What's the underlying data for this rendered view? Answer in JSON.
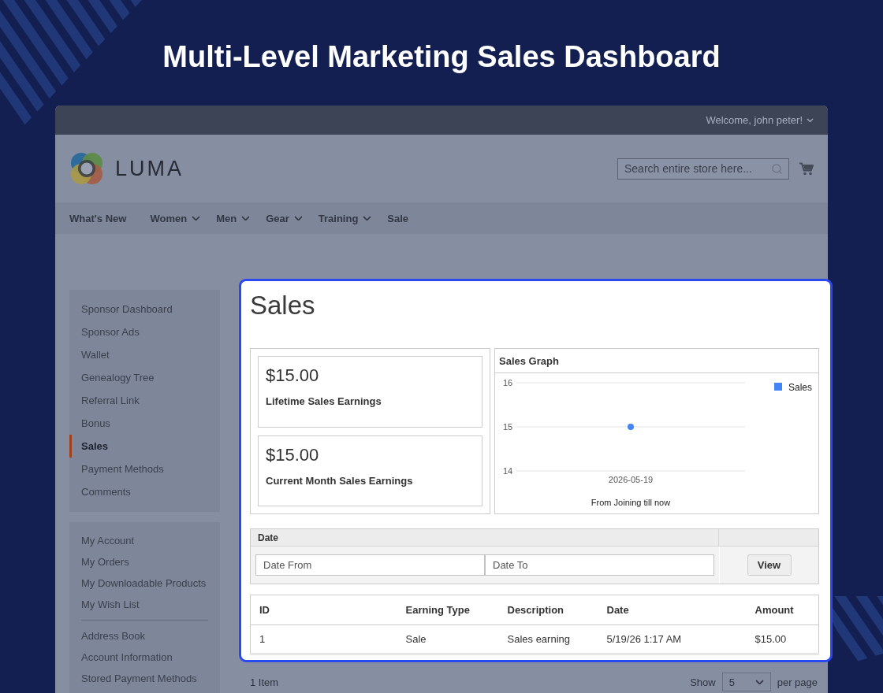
{
  "page_title": "Multi-Level Marketing Sales Dashboard",
  "top_bar": {
    "welcome": "Welcome, john peter!"
  },
  "header": {
    "logo_text": "LUMA",
    "search": {
      "placeholder": "Search entire store here..."
    }
  },
  "nav": [
    {
      "label": "What's New",
      "has_menu": false
    },
    {
      "label": "Women",
      "has_menu": true
    },
    {
      "label": "Men",
      "has_menu": true
    },
    {
      "label": "Gear",
      "has_menu": true
    },
    {
      "label": "Training",
      "has_menu": true
    },
    {
      "label": "Sale",
      "has_menu": false
    }
  ],
  "sidebar": [
    {
      "sections": [
        {
          "items": [
            {
              "label": "Sponsor Dashboard",
              "selected": false
            },
            {
              "label": "Sponsor Ads",
              "selected": false
            },
            {
              "label": "Wallet",
              "selected": false
            },
            {
              "label": "Genealogy Tree",
              "selected": false
            },
            {
              "label": "Referral Link",
              "selected": false
            },
            {
              "label": "Bonus",
              "selected": false
            },
            {
              "label": "Sales",
              "selected": true
            },
            {
              "label": "Payment Methods",
              "selected": false
            },
            {
              "label": "Comments",
              "selected": false
            }
          ]
        }
      ]
    },
    {
      "sections": [
        {
          "items": [
            {
              "label": "My Account",
              "selected": false
            },
            {
              "label": "My Orders",
              "selected": false
            },
            {
              "label": "My Downloadable Products",
              "selected": false
            },
            {
              "label": "My Wish List",
              "selected": false
            }
          ]
        },
        {
          "items": [
            {
              "label": "Address Book",
              "selected": false
            },
            {
              "label": "Account Information",
              "selected": false
            },
            {
              "label": "Stored Payment Methods",
              "selected": false
            }
          ]
        }
      ]
    }
  ],
  "sales": {
    "title": "Sales",
    "stats": [
      {
        "amount": "$15.00",
        "label": "Lifetime Sales Earnings"
      },
      {
        "amount": "$15.00",
        "label": "Current Month Sales Earnings"
      }
    ],
    "graph": {
      "title": "Sales Graph",
      "chart_data": {
        "type": "line",
        "xlabel": "From Joining till now",
        "categories": [
          "2026-05-19"
        ],
        "series": [
          {
            "name": "Sales",
            "color": "#4285f4",
            "marker": "circle",
            "values": [
              15
            ]
          }
        ],
        "ylim": [
          14,
          16
        ],
        "yticks": [
          14,
          15,
          16
        ]
      }
    },
    "filter": {
      "label": "Date",
      "fields": [
        {
          "placeholder": "Date From"
        },
        {
          "placeholder": "Date To"
        }
      ],
      "button": "View"
    },
    "table": {
      "columns": [
        "ID",
        "Earning Type",
        "Description",
        "Date",
        "Amount"
      ],
      "rows": [
        [
          "1",
          "Sale",
          "Sales earning",
          "5/19/26 1:17 AM",
          "$15.00"
        ]
      ]
    }
  },
  "pager": {
    "count": "1 Item",
    "show_label": "Show",
    "per_page": "5",
    "per_page_label": "per page"
  }
}
